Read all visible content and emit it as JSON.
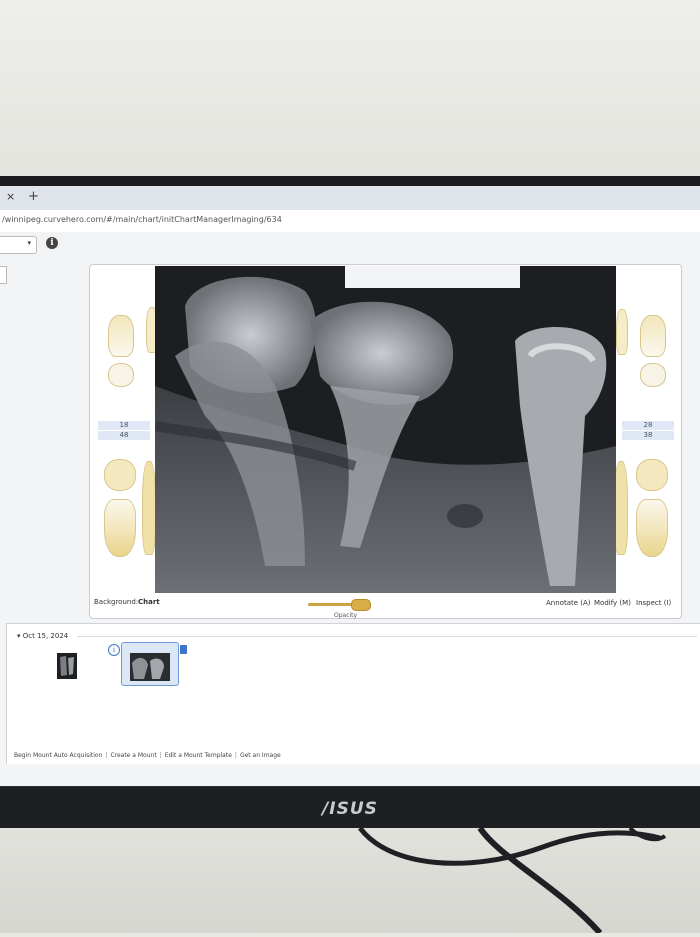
{
  "browser": {
    "tab_close": "×",
    "new_tab": "+",
    "url": "/winnipeg.curvehero.com/#/main/chart/initChartManagerImaging/634"
  },
  "toolbar": {
    "select_caret": "▾",
    "info": "i"
  },
  "tooth_chart": {
    "left_labels": [
      "18",
      "48"
    ],
    "right_labels": [
      "28",
      "38"
    ]
  },
  "viewer_footer": {
    "background_label": "Background:",
    "background_value": "Chart",
    "opacity_label": "Opacity",
    "opacity_value": 0.85,
    "annotate": "Annotate (A)",
    "modify": "Modify (M)",
    "inspect": "Inspect (I)"
  },
  "timeline": {
    "date": "▾ Oct 15, 2024",
    "info": "i"
  },
  "bottom_links": [
    "Begin Mount Auto Acquisition",
    "Create a Mount",
    "Edit a Mount Template",
    "Get an Image"
  ],
  "monitor": {
    "brand": "/ISUS"
  },
  "colors": {
    "accent": "#3b74c9",
    "slider": "#d9ad48",
    "bezel": "#1b1b1d"
  }
}
